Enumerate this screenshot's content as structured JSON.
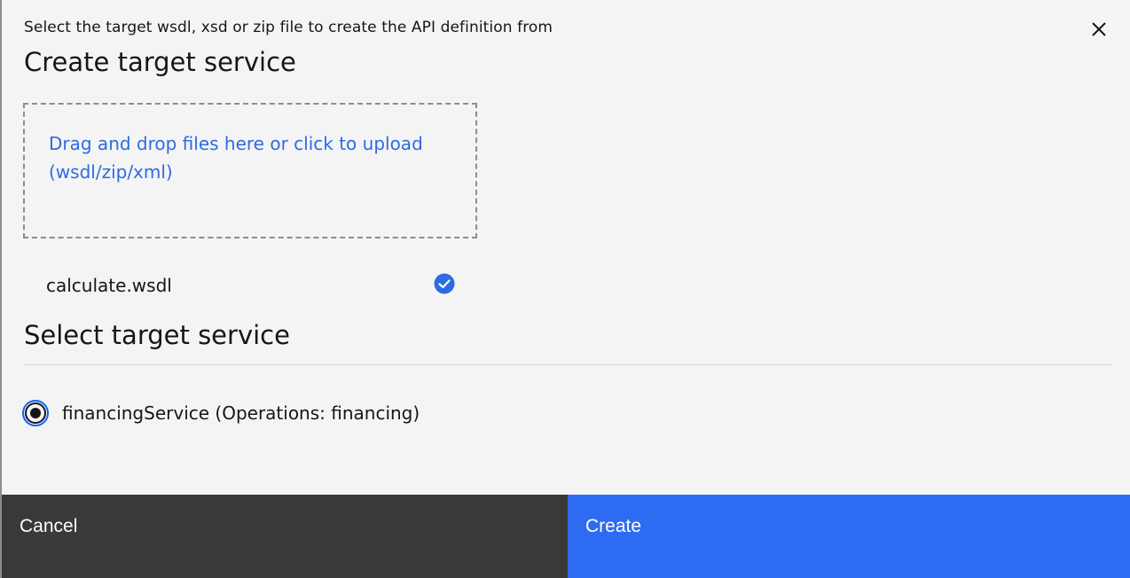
{
  "dialog": {
    "subtitle": "Select the target wsdl, xsd or zip file to create the API definition from",
    "title": "Create target service",
    "close_icon": "close-icon"
  },
  "upload": {
    "dropzone_text": "Drag and drop files here or click to upload (wsdl/zip/xml)",
    "files": [
      {
        "name": "calculate.wsdl",
        "status_icon": "checkmark-filled-icon",
        "status_color": "#2d6be4"
      }
    ]
  },
  "select_service": {
    "title": "Select target service",
    "options": [
      {
        "label": "financingService (Operations: financing)",
        "selected": true
      }
    ]
  },
  "footer": {
    "cancel_label": "Cancel",
    "create_label": "Create"
  },
  "colors": {
    "primary": "#2d6bf2",
    "secondary": "#393939",
    "link": "#2d6be4",
    "background": "#f4f4f4"
  }
}
